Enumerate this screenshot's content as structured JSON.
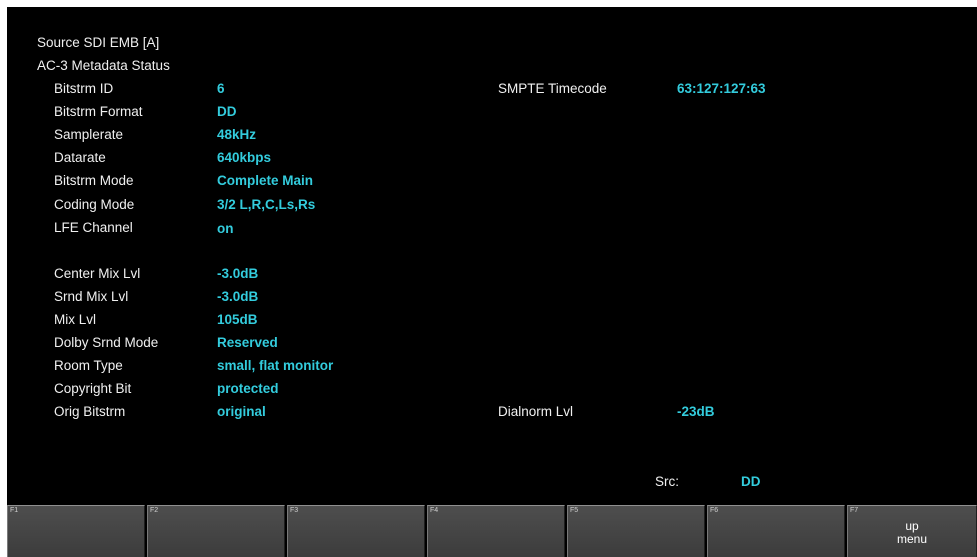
{
  "header": {
    "source": "Source SDI EMB [A]",
    "title": "AC-3 Metadata Status"
  },
  "params_left": [
    {
      "label": "Bitstrm ID",
      "value": "6"
    },
    {
      "label": "Bitstrm Format",
      "value": "DD"
    },
    {
      "label": "Samplerate",
      "value": "48kHz"
    },
    {
      "label": "Datarate",
      "value": "640kbps"
    },
    {
      "label": "Bitstrm Mode",
      "value": "Complete Main"
    },
    {
      "label": "Coding Mode",
      "value": "3/2 L,R,C,Ls,Rs"
    },
    {
      "label": "LFE Channel",
      "value": "on"
    },
    {
      "label": "Center Mix Lvl",
      "value": "-3.0dB"
    },
    {
      "label": "Srnd Mix Lvl",
      "value": "-3.0dB"
    },
    {
      "label": "Mix Lvl",
      "value": "105dB"
    },
    {
      "label": "Dolby Srnd Mode",
      "value": "Reserved"
    },
    {
      "label": "Room Type",
      "value": "small, flat monitor"
    },
    {
      "label": "Copyright Bit",
      "value": "protected"
    },
    {
      "label": "Orig Bitstrm",
      "value": "original"
    }
  ],
  "params_right": [
    {
      "label": "SMPTE Timecode",
      "value": "63:127:127:63"
    },
    {
      "label": "Dialnorm Lvl",
      "value": "-23dB"
    }
  ],
  "source_status": {
    "label": "Src:",
    "value": "DD"
  },
  "function_keys": [
    {
      "id": "F1",
      "label": ""
    },
    {
      "id": "F2",
      "label": ""
    },
    {
      "id": "F3",
      "label": ""
    },
    {
      "id": "F4",
      "label": ""
    },
    {
      "id": "F5",
      "label": ""
    },
    {
      "id": "F6",
      "label": ""
    },
    {
      "id": "F7",
      "label": "up\nmenu"
    }
  ],
  "colors": {
    "background": "#000000",
    "label_text": "#f0f0f0",
    "value_text": "#33ccdd",
    "fkey_background": "#444444"
  }
}
